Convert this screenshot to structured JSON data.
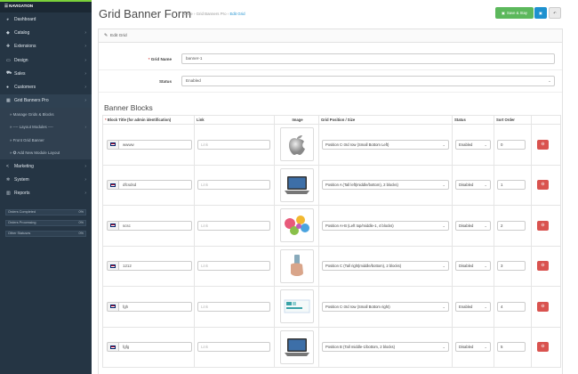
{
  "sidebar": {
    "nav_header": "NAVIGATION",
    "items": [
      {
        "label": "Dashboard",
        "icon": "dashboard-icon",
        "glyph": "◕",
        "chevron": ""
      },
      {
        "label": "Catalog",
        "icon": "tag-icon",
        "glyph": "◆",
        "chevron": "›"
      },
      {
        "label": "Extensions",
        "icon": "puzzle-icon",
        "glyph": "✚",
        "chevron": "›"
      },
      {
        "label": "Design",
        "icon": "monitor-icon",
        "glyph": "▭",
        "chevron": "›"
      },
      {
        "label": "Sales",
        "icon": "cart-icon",
        "glyph": "⛟",
        "chevron": "›"
      },
      {
        "label": "Customers",
        "icon": "user-icon",
        "glyph": "●",
        "chevron": "›"
      },
      {
        "label": "Grid Banners Pro",
        "icon": "grid-icon",
        "glyph": "▦",
        "chevron": "›"
      }
    ],
    "sub_items": [
      {
        "label": "» Manage Grids & Blocks",
        "chevron": ""
      },
      {
        "label": "» ---- Layout Modules ----",
        "chevron": "›"
      },
      {
        "label": "» Front Grid Banner",
        "chevron": ""
      },
      {
        "label": "» ✪ Add New Module Layout",
        "chevron": ""
      }
    ],
    "items_after": [
      {
        "label": "Marketing",
        "icon": "share-icon",
        "glyph": "<",
        "chevron": "›"
      },
      {
        "label": "System",
        "icon": "gear-icon",
        "glyph": "✲",
        "chevron": "›"
      },
      {
        "label": "Reports",
        "icon": "bar-chart-icon",
        "glyph": "▥",
        "chevron": "›"
      }
    ],
    "stats": [
      {
        "label": "Orders Completed",
        "value": "0%"
      },
      {
        "label": "Orders Processing",
        "value": "0%"
      },
      {
        "label": "Other Statuses",
        "value": "0%"
      }
    ]
  },
  "header": {
    "title": "Grid Banner Form",
    "breadcrumbs": [
      "Home",
      "Grid Banners Pro",
      "Edit Grid"
    ],
    "save_stay_label": "Save & Stay",
    "save_icon": "floppy-icon",
    "back_icon": "reply-icon"
  },
  "panel": {
    "heading": "Edit Grid",
    "grid_name_label": "Grid Name",
    "grid_name_value": "banner-1",
    "status_label": "Status",
    "status_value": "Enabled",
    "section_title": "Banner Blocks",
    "columns": [
      "Block Title (for admin identification)",
      "Link",
      "Image",
      "Grid Position / Size",
      "Status",
      "Sort Order",
      ""
    ],
    "link_placeholder": "Link",
    "rows": [
      {
        "title": "wwww",
        "image": "apple-logo",
        "position": "Position C-3rd row (Small Bottom Left)",
        "status": "Enabled",
        "sort": "0"
      },
      {
        "title": "dfcsdsd",
        "image": "laptop",
        "position": "Position A (Tall left|middle/bottom), 2 blocks)",
        "status": "Disabled",
        "sort": "1"
      },
      {
        "title": "scsc",
        "image": "candy",
        "position": "Position A+B (Left top/middle-1, 4 blocks)",
        "status": "Disabled",
        "sort": "2"
      },
      {
        "title": "1212",
        "image": "hand-device",
        "position": "Position C (Tall right|middle/bottom), 2 blocks)",
        "status": "Disabled",
        "sort": "3"
      },
      {
        "title": "fgh",
        "image": "web-banner",
        "position": "Position C-3rd row (Small Bottom right)",
        "status": "Enabled",
        "sort": "4"
      },
      {
        "title": "fgfg",
        "image": "laptop",
        "position": "Position B (Tall middle-1/bottom, 2 blocks)",
        "status": "Disabled",
        "sort": "5"
      }
    ]
  },
  "colors": {
    "sidebar_bg": "#253544",
    "save_stay": "#5cb85c",
    "save": "#1e91cf",
    "delete": "#d9534f",
    "required": "#d9534f"
  }
}
